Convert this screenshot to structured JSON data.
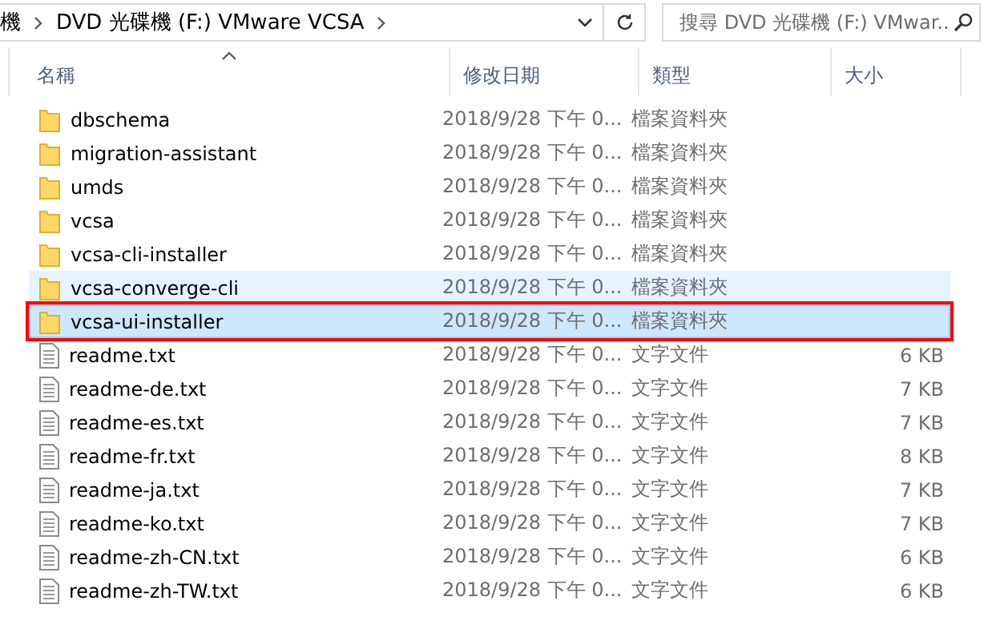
{
  "address_bar": {
    "crumbs": [
      "機",
      "DVD 光碟機 (F:) VMware VCSA"
    ]
  },
  "search": {
    "placeholder": "搜尋 DVD 光碟機 (F:) VMwar..."
  },
  "table": {
    "columns": [
      {
        "label": "名稱",
        "sorted": true
      },
      {
        "label": "修改日期",
        "sorted": false
      },
      {
        "label": "類型",
        "sorted": false
      },
      {
        "label": "大小",
        "sorted": false
      }
    ],
    "rows": [
      {
        "kind": "folder",
        "name": "dbschema",
        "date": "2018/9/28 下午 0...",
        "type": "檔案資料夾",
        "selected": false,
        "hovered": false,
        "outlined": false
      },
      {
        "kind": "folder",
        "name": "migration-assistant",
        "date": "2018/9/28 下午 0...",
        "type": "檔案資料夾",
        "selected": false,
        "hovered": false,
        "outlined": false
      },
      {
        "kind": "folder",
        "name": "umds",
        "date": "2018/9/28 下午 0...",
        "type": "檔案資料夾",
        "selected": false,
        "hovered": false,
        "outlined": false
      },
      {
        "kind": "folder",
        "name": "vcsa",
        "date": "2018/9/28 下午 0...",
        "type": "檔案資料夾",
        "selected": false,
        "hovered": false,
        "outlined": false
      },
      {
        "kind": "folder",
        "name": "vcsa-cli-installer",
        "date": "2018/9/28 下午 0...",
        "type": "檔案資料夾",
        "selected": false,
        "hovered": false,
        "outlined": false
      },
      {
        "kind": "folder",
        "name": "vcsa-converge-cli",
        "date": "2018/9/28 下午 0...",
        "type": "檔案資料夾",
        "selected": false,
        "hovered": true,
        "outlined": false
      },
      {
        "kind": "folder",
        "name": "vcsa-ui-installer",
        "date": "2018/9/28 下午 0...",
        "type": "檔案資料夾",
        "selected": true,
        "hovered": false,
        "outlined": true
      },
      {
        "kind": "file",
        "name": "readme.txt",
        "date": "2018/9/28 下午 0...",
        "type": "文字文件",
        "size": "6 KB",
        "selected": false,
        "hovered": false,
        "outlined": false
      },
      {
        "kind": "file",
        "name": "readme-de.txt",
        "date": "2018/9/28 下午 0...",
        "type": "文字文件",
        "size": "7 KB",
        "selected": false,
        "hovered": false,
        "outlined": false
      },
      {
        "kind": "file",
        "name": "readme-es.txt",
        "date": "2018/9/28 下午 0...",
        "type": "文字文件",
        "size": "7 KB",
        "selected": false,
        "hovered": false,
        "outlined": false
      },
      {
        "kind": "file",
        "name": "readme-fr.txt",
        "date": "2018/9/28 下午 0...",
        "type": "文字文件",
        "size": "8 KB",
        "selected": false,
        "hovered": false,
        "outlined": false
      },
      {
        "kind": "file",
        "name": "readme-ja.txt",
        "date": "2018/9/28 下午 0...",
        "type": "文字文件",
        "size": "7 KB",
        "selected": false,
        "hovered": false,
        "outlined": false
      },
      {
        "kind": "file",
        "name": "readme-ko.txt",
        "date": "2018/9/28 下午 0...",
        "type": "文字文件",
        "size": "7 KB",
        "selected": false,
        "hovered": false,
        "outlined": false
      },
      {
        "kind": "file",
        "name": "readme-zh-CN.txt",
        "date": "2018/9/28 下午 0...",
        "type": "文字文件",
        "size": "6 KB",
        "selected": false,
        "hovered": false,
        "outlined": false
      },
      {
        "kind": "file",
        "name": "readme-zh-TW.txt",
        "date": "2018/9/28 下午 0...",
        "type": "文字文件",
        "size": "6 KB",
        "selected": false,
        "hovered": false,
        "outlined": false
      }
    ]
  }
}
